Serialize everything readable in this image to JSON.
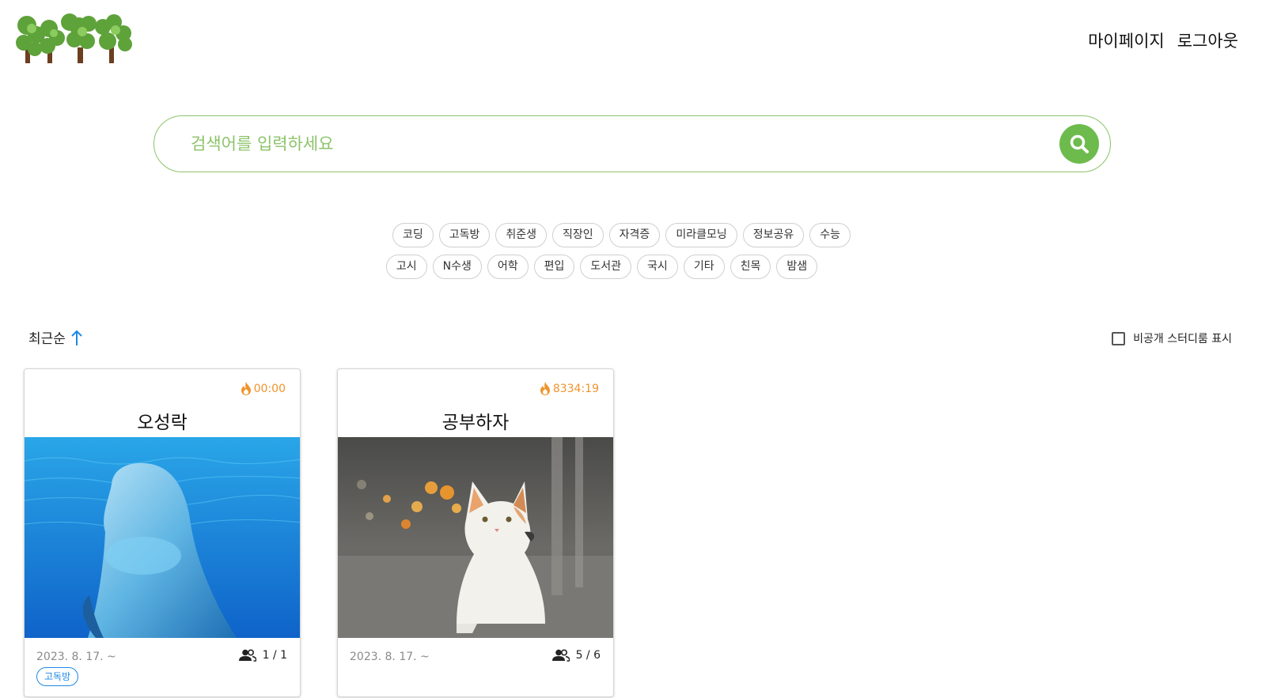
{
  "header": {
    "nav": [
      "마이페이지",
      "로그아웃"
    ]
  },
  "search": {
    "placeholder": "검색어를 입력하세요"
  },
  "tags": {
    "row1": [
      "코딩",
      "고독방",
      "취준생",
      "직장인",
      "자격증",
      "미라클모닝",
      "정보공유",
      "수능"
    ],
    "row2": [
      "고시",
      "N수생",
      "어학",
      "편입",
      "도서관",
      "국시",
      "기타",
      "친목",
      "밤샘"
    ]
  },
  "sort": {
    "label": "최근순",
    "direction": "ascending"
  },
  "private_filter": {
    "label": "비공개 스터디룸 표시",
    "checked": false
  },
  "cards": [
    {
      "timer": "00:00",
      "title": "오성락",
      "image": "dolphin-underwater",
      "date": "2023. 8. 17. ~",
      "members": "1 / 1",
      "tag": "고독방"
    },
    {
      "timer": "8334:19",
      "title": "공부하자",
      "image": "white-cat-street",
      "date": "2023. 8. 17. ~",
      "members": "5 / 6",
      "tag": ""
    }
  ],
  "colors": {
    "accent_green": "#6dbb4d",
    "timer_orange": "#f0932b",
    "badge_blue": "#1e88e5"
  }
}
